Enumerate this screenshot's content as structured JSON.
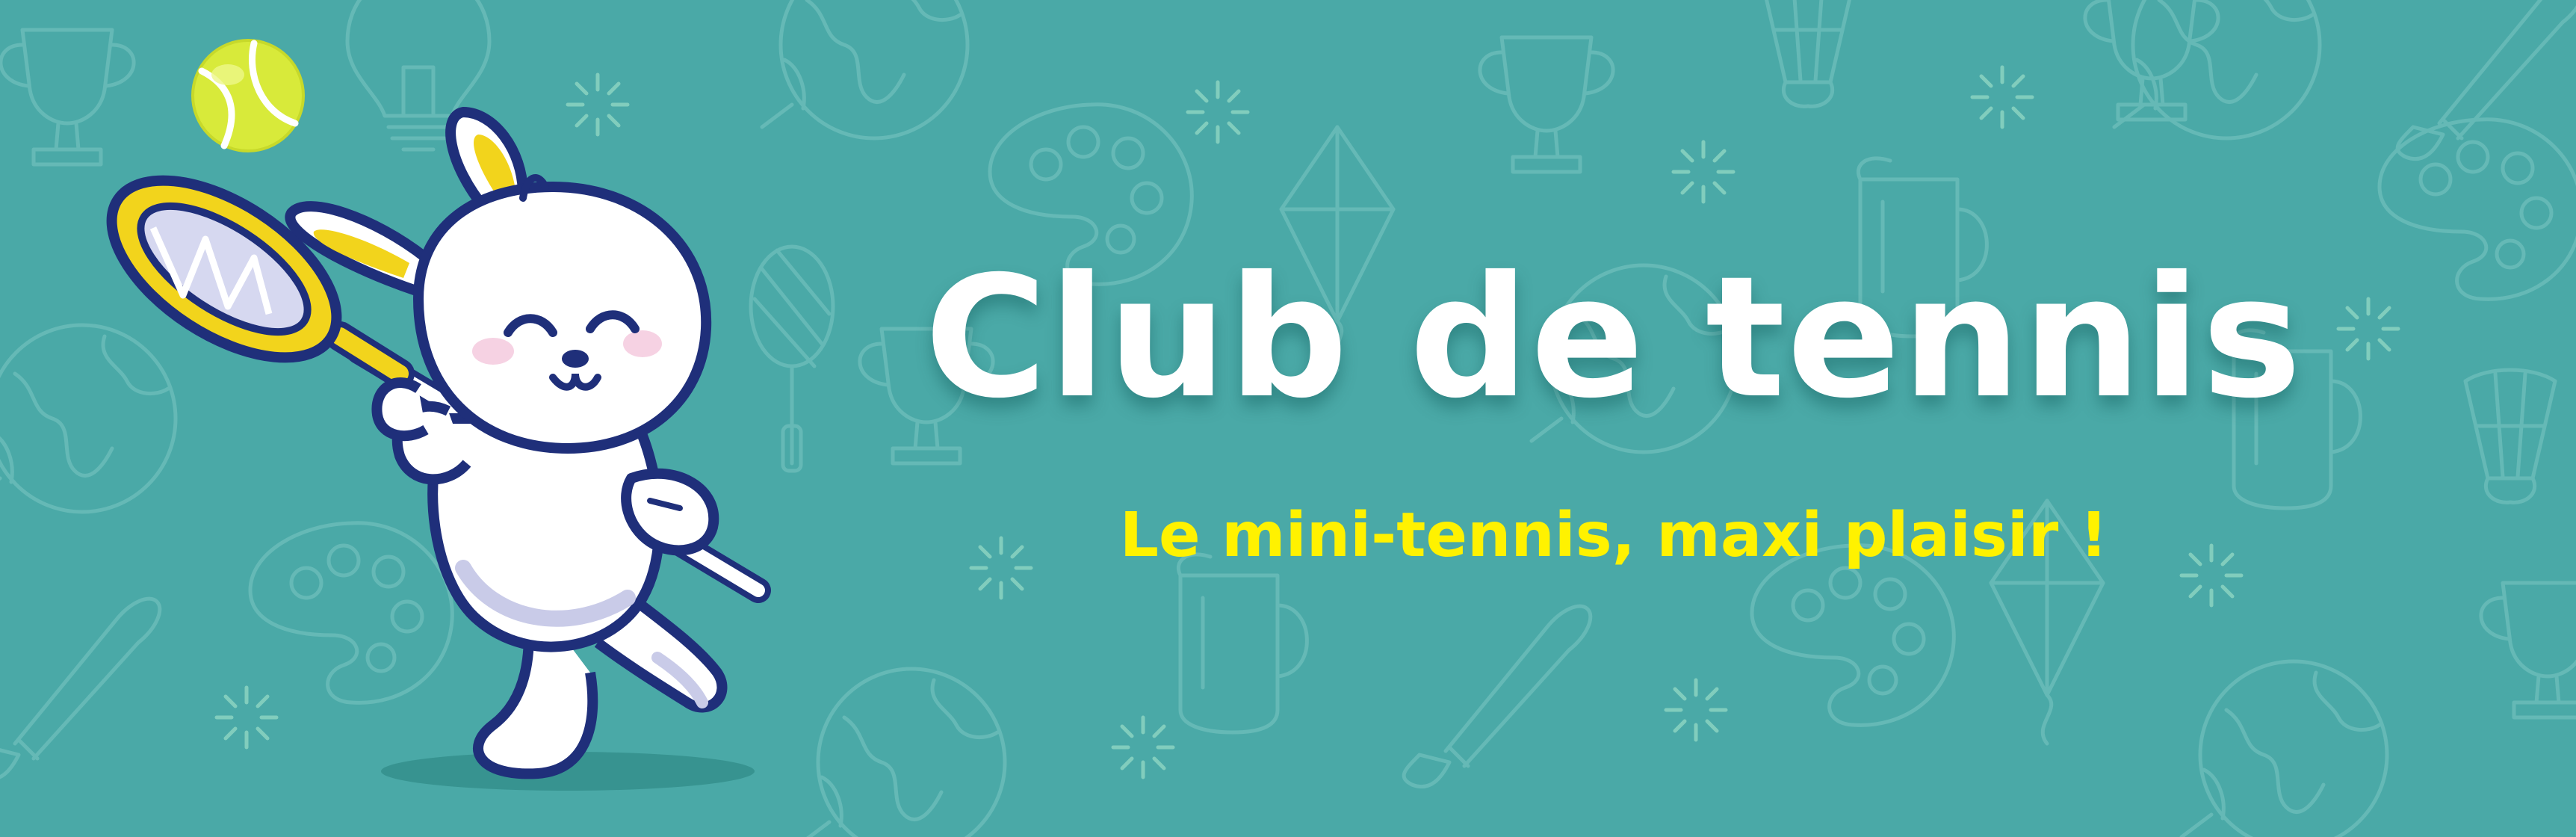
{
  "banner": {
    "title": "Club de tennis",
    "subtitle": "Le mini-tennis, maxi plaisir !",
    "mascot": "bunny-tennis-player",
    "background_pattern": "sketch-doodles"
  },
  "colors": {
    "background": "#4aa9a7",
    "doodle_stroke": "#7cc7c3",
    "title": "#ffffff",
    "subtitle": "#fff200",
    "outline": "#1f2f7a",
    "racket": "#f2d41c",
    "ball": "#d8ea3a",
    "bunny_body": "#ffffff",
    "bunny_shade": "#c9cbe8"
  },
  "icons": [
    "tennis-ball-icon",
    "tennis-racket-icon",
    "paint-palette-icon",
    "paint-brush-icon",
    "trophy-icon",
    "globe-icon",
    "mug-icon",
    "kite-icon",
    "shuttlecock-icon",
    "light-bulb-icon"
  ]
}
